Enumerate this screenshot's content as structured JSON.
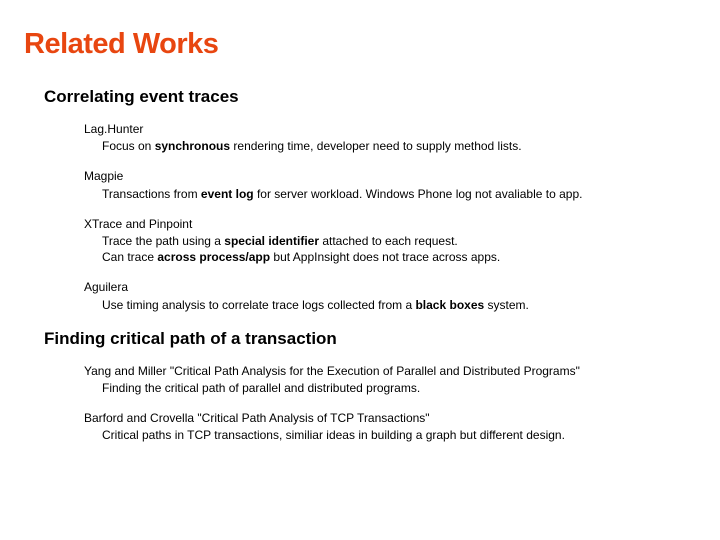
{
  "title": "Related Works",
  "section1": {
    "heading": "Correlating event traces",
    "items": [
      {
        "title": "Lag.Hunter",
        "desc_pre": "Focus on ",
        "desc_bold1": "synchronous",
        "desc_post": " rendering time, developer need to supply method lists."
      },
      {
        "title": "Magpie",
        "desc_pre": "Transactions from ",
        "desc_bold1": "event log",
        "desc_post": " for server workload. Windows Phone log not avaliable to app."
      },
      {
        "title": "XTrace and Pinpoint",
        "line1_pre": "Trace the path using a ",
        "line1_bold": "special identifier",
        "line1_post": " attached to each request.",
        "line2_pre": "Can trace ",
        "line2_bold": "across process/app",
        "line2_post": " but AppInsight does not trace across apps."
      },
      {
        "title": "Aguilera",
        "desc_pre": "Use timing analysis to correlate trace logs collected from a ",
        "desc_bold1": "black boxes",
        "desc_post": " system."
      }
    ]
  },
  "section2": {
    "heading": "Finding critical path of a transaction",
    "items": [
      {
        "title": "Yang and Miller \"Critical Path Analysis for the Execution of Parallel and Distributed Programs\"",
        "desc": "Finding the critical path of parallel and distributed programs."
      },
      {
        "title": "Barford and Crovella \"Critical Path Analysis of TCP Transactions\"",
        "desc": "Critical paths in TCP transactions, similiar ideas in building a graph but different design."
      }
    ]
  }
}
